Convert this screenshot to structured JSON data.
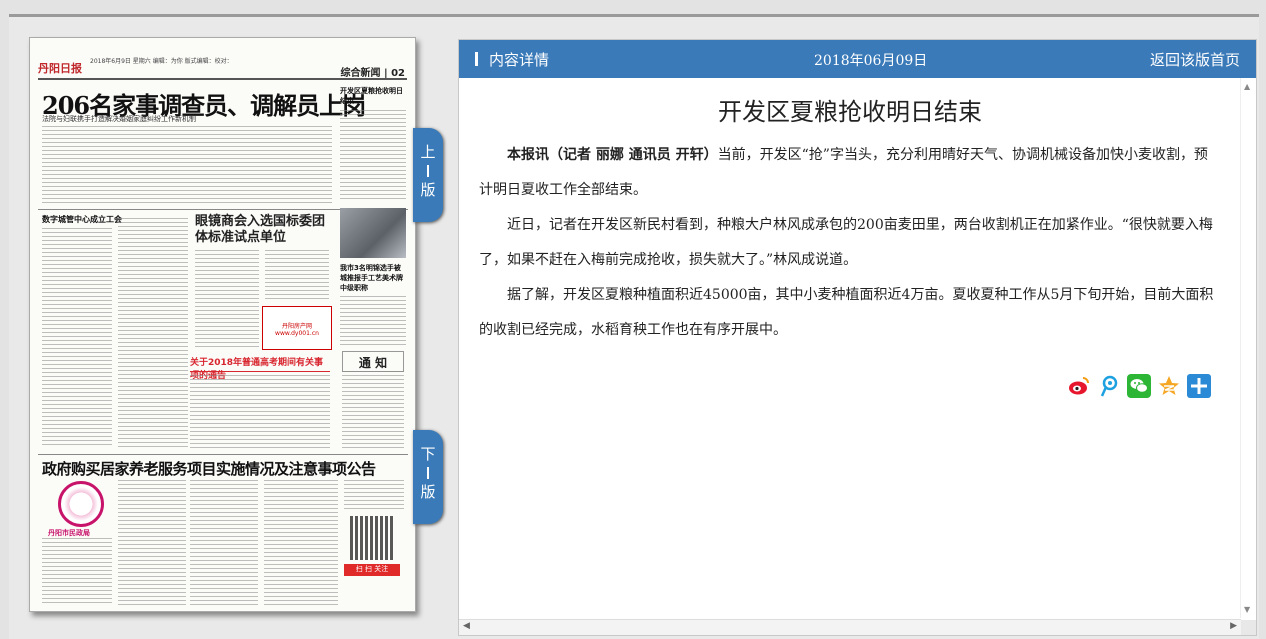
{
  "paper": {
    "masthead": "丹阳日报",
    "masthead_info": "2018年6月9日 星期六 编辑：为你 版式编辑：校对：",
    "section": "综合新闻 | 02",
    "headline": "206名家事调查员、调解员上岗",
    "subheadline": "法院与妇联携手打造解决婚姻家庭纠纷工作新机制",
    "side_headline": "开发区夏粮抢收明日结束",
    "story2_title": "数字城管中心成立工会",
    "story3_title": "眼镜商会入选国标委团体标准试点单位",
    "story4_title": "我市3名明锦选手被城推报手工艺美术牌中级职称",
    "red_headline": "关于2018年普通高考期间有关事项的通告",
    "notice": "通 知",
    "bottom_headline": "政府购买居家养老服务项目实施情况及注意事项公告",
    "logo_text": "丹阳市民政局",
    "ad_text": "丹阳房产网 www.dy001.cn",
    "qr_label": "扫 扫 关注"
  },
  "page_nav": {
    "prev": [
      "上",
      "版"
    ],
    "next": [
      "下",
      "版"
    ]
  },
  "header": {
    "section_title": "内容详情",
    "date": "2018年06月09日",
    "home_link": "返回该版首页"
  },
  "article": {
    "title": "开发区夏粮抢收明日结束",
    "byline": "本报讯（记者 丽娜 通讯员 开轩）",
    "paragraphs": [
      "当前，开发区“抢”字当头，充分利用晴好天气、协调机械设备加快小麦收割，预计明日夏收工作全部结束。",
      "近日，记者在开发区新民村看到，种粮大户林风成承包的200亩麦田里，两台收割机正在加紧作业。“很快就要入梅了，如果不赶在入梅前完成抢收，损失就大了。”林风成说道。",
      "据了解，开发区夏粮种植面积近45000亩，其中小麦种植面积近4万亩。夏收夏种工作从5月下旬开始，目前大面积的收割已经完成，水稻育秧工作也在有序开展中。"
    ]
  },
  "share_icons": [
    "weibo-icon",
    "tencent-weibo-icon",
    "wechat-icon",
    "qzone-icon",
    "more-share-icon"
  ],
  "colors": {
    "accent": "#3a7ab8",
    "weibo": "#e6162d",
    "tencent": "#1da1e0",
    "wechat": "#2db535",
    "qzone": "#f5a623",
    "more": "#2a8ad6"
  }
}
